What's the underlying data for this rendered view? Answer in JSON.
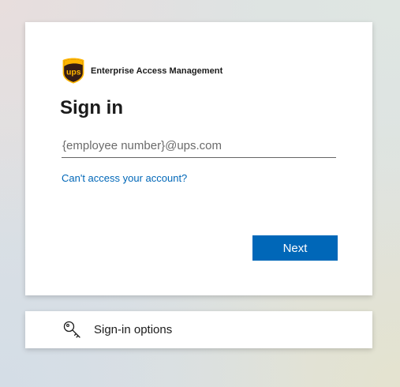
{
  "brand": {
    "logo_text": "ups",
    "name": "Enterprise Access Management",
    "logo_colors": {
      "shield": "#351c15",
      "accent": "#ffb500"
    }
  },
  "signin": {
    "title": "Sign in",
    "email_placeholder": "{employee number}@ups.com",
    "email_value": "",
    "help_link": "Can't access your account?",
    "next_label": "Next"
  },
  "options": {
    "icon": "key-icon",
    "label": "Sign-in options"
  },
  "colors": {
    "primary": "#0067b8",
    "link": "#0067b8",
    "text": "#1b1b1b"
  }
}
